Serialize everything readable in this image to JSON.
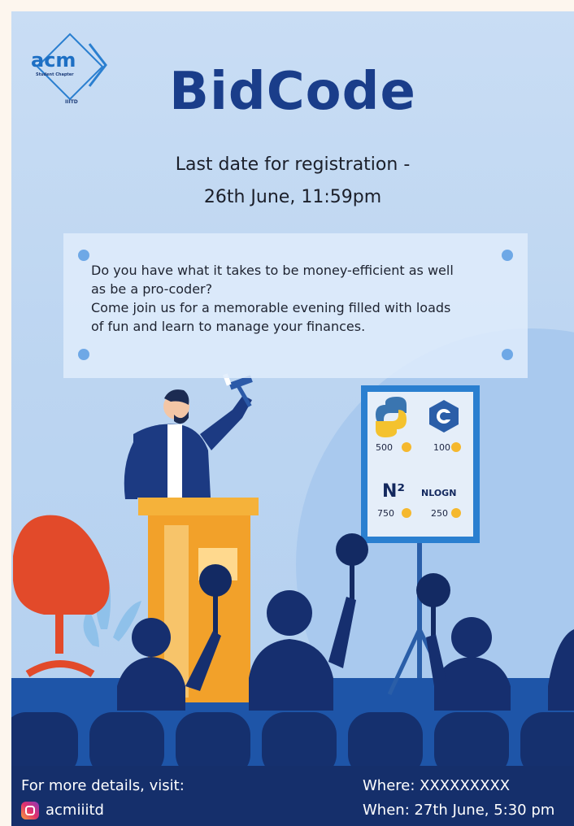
{
  "logo": {
    "name": "acm",
    "sub": "Student Chapter",
    "tag": "IIITD"
  },
  "title": "BidCode",
  "registration": {
    "line1": "Last date for registration -",
    "line2": "26th June, 11:59pm"
  },
  "description": {
    "line1": "Do you have what it takes to be money-efficient as well",
    "line2": "as be a pro-coder?",
    "line3": "Come join us for a memorable evening filled with loads",
    "line4": "of fun and learn to manage your finances."
  },
  "board": {
    "items": [
      {
        "label": "python",
        "price": "500"
      },
      {
        "label": "C++",
        "price": "100"
      },
      {
        "label": "N²",
        "price": "750"
      },
      {
        "label": "NLOGN",
        "price": "250"
      }
    ]
  },
  "footer": {
    "details": "For more details, visit:",
    "handle": "acmiiitd",
    "where": "Where: XXXXXXXXX",
    "when": "When: 27th June, 5:30 pm"
  },
  "colors": {
    "title": "#1a3d8a",
    "navy": "#15306e",
    "footer_bg": "#152f6b",
    "podium": "#f2a12a",
    "chair": "#e24a2a",
    "board_frame": "#2a7fd0",
    "coin": "#f5b82e"
  }
}
